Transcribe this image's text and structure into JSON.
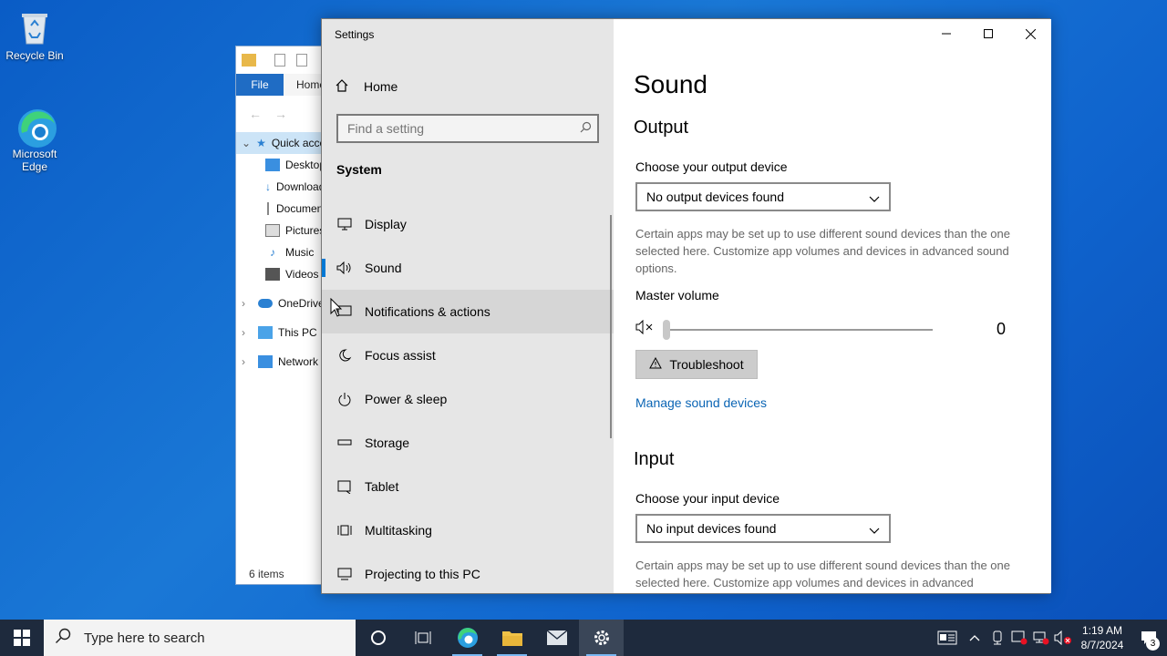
{
  "desktop": {
    "icons": [
      {
        "label": "Recycle Bin",
        "icon": "recycle-bin-icon"
      },
      {
        "label": "Microsoft Edge",
        "icon": "edge-icon"
      }
    ]
  },
  "explorer": {
    "ribbon": {
      "file": "File",
      "home": "Home"
    },
    "tree": [
      {
        "label": "Quick access"
      },
      {
        "label": "Desktop"
      },
      {
        "label": "Downloads"
      },
      {
        "label": "Documents"
      },
      {
        "label": "Pictures"
      },
      {
        "label": "Music"
      },
      {
        "label": "Videos"
      },
      {
        "label": "OneDrive"
      },
      {
        "label": "This PC"
      },
      {
        "label": "Network"
      }
    ],
    "status": "6 items"
  },
  "settings": {
    "title": "Settings",
    "home": "Home",
    "search_placeholder": "Find a setting",
    "section": "System",
    "nav": [
      {
        "label": "Display",
        "icon": "display-icon"
      },
      {
        "label": "Sound",
        "icon": "speaker-icon"
      },
      {
        "label": "Notifications & actions",
        "icon": "notifications-icon"
      },
      {
        "label": "Focus assist",
        "icon": "moon-icon"
      },
      {
        "label": "Power & sleep",
        "icon": "power-icon"
      },
      {
        "label": "Storage",
        "icon": "storage-icon"
      },
      {
        "label": "Tablet",
        "icon": "tablet-icon"
      },
      {
        "label": "Multitasking",
        "icon": "multitasking-icon"
      },
      {
        "label": "Projecting to this PC",
        "icon": "projecting-icon"
      }
    ],
    "active_nav": "Sound",
    "page_title": "Sound",
    "output": {
      "heading": "Output",
      "label": "Choose your output device",
      "device": "No output devices found",
      "desc": "Certain apps may be set up to use different sound devices than the one selected here. Customize app volumes and devices in advanced sound options.",
      "master_volume_label": "Master volume",
      "master_volume_value": "0",
      "troubleshoot": "Troubleshoot",
      "manage_link": "Manage sound devices"
    },
    "input": {
      "heading": "Input",
      "label": "Choose your input device",
      "device": "No input devices found",
      "desc": "Certain apps may be set up to use different sound devices than the one selected here. Customize app volumes and devices in advanced"
    }
  },
  "taskbar": {
    "search_placeholder": "Type here to search",
    "time": "1:19 AM",
    "date": "8/7/2024",
    "notification_count": "3"
  }
}
